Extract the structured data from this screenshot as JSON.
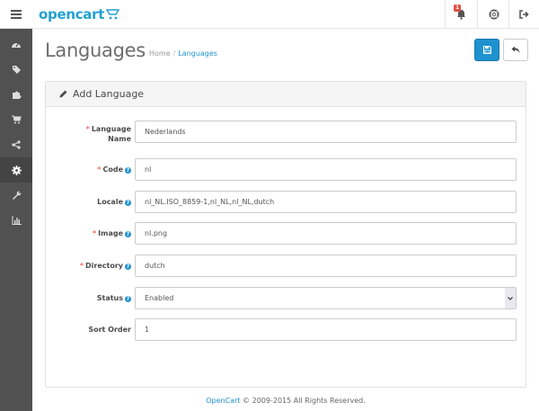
{
  "header": {
    "logo_text": "opencart",
    "notification_count": "1"
  },
  "sidebar": {
    "items": [
      {
        "icon": "dashboard-icon"
      },
      {
        "icon": "tags-icon"
      },
      {
        "icon": "puzzle-icon"
      },
      {
        "icon": "shopping-cart-icon"
      },
      {
        "icon": "share-icon"
      },
      {
        "icon": "cog-icon",
        "active": true
      },
      {
        "icon": "wrench-icon"
      },
      {
        "icon": "bar-chart-icon"
      }
    ]
  },
  "page": {
    "title": "Languages",
    "breadcrumb": {
      "home": "Home",
      "separator": "/",
      "current": "Languages"
    }
  },
  "panel": {
    "title": "Add Language"
  },
  "form": {
    "name": {
      "label_line1": "Language",
      "label_line2": "Name",
      "required": "*",
      "value": "Nederlands"
    },
    "code": {
      "label": "Code",
      "required": "*",
      "value": "nl"
    },
    "locale": {
      "label": "Locale",
      "value": "nl_NL.ISO_8859-1,nl_NL,nl_NL,dutch"
    },
    "image": {
      "label": "Image",
      "required": "*",
      "value": "nl.png"
    },
    "directory": {
      "label": "Directory",
      "required": "*",
      "value": "dutch"
    },
    "status": {
      "label": "Status",
      "value": "Enabled"
    },
    "sort_order": {
      "label": "Sort Order",
      "value": "1"
    }
  },
  "footer": {
    "brand": "OpenCart",
    "text": " © 2009-2015 All Rights Reserved."
  },
  "colors": {
    "accent": "#1e91cf",
    "sidebar": "#515151",
    "required": "#f56b6b",
    "badge": "#e3503e"
  }
}
